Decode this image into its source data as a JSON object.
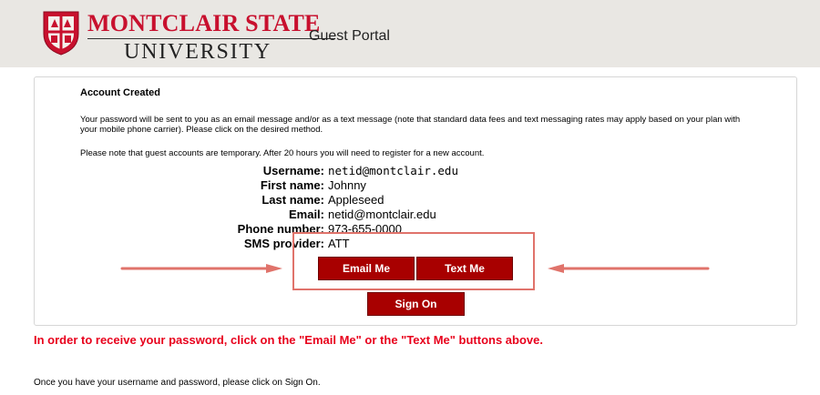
{
  "header": {
    "logo_top": "MONTCLAIR STATE",
    "logo_bottom": "UNIVERSITY",
    "portal_title": "Guest Portal",
    "brand_color": "#c8102e"
  },
  "card": {
    "title": "Account Created",
    "paragraph1": "Your password will be sent to you as an email message and/or as a text message (note that standard data fees and text messaging rates may apply based on your plan with your mobile phone carrier).  Please click on the desired method.",
    "paragraph2": "Please note that guest accounts are temporary. After 20 hours you will need to register for a new account.",
    "fields": [
      {
        "label": "Username:",
        "value": "netid@montclair.edu"
      },
      {
        "label": "First name:",
        "value": "Johnny"
      },
      {
        "label": "Last name:",
        "value": "Appleseed"
      },
      {
        "label": "Email:",
        "value": "netid@montclair.edu"
      },
      {
        "label": "Phone number:",
        "value": "973-655-0000"
      },
      {
        "label": "SMS provider:",
        "value": "ATT"
      }
    ],
    "buttons": {
      "email_me": "Email Me",
      "text_me": "Text Me",
      "sign_on": "Sign On"
    },
    "button_color": "#a80000",
    "highlight_color": "#e0736b"
  },
  "warning": "In order to receive your password, click on the \"Email Me\" or the \"Text Me\" buttons above.",
  "footer": "Once you have your username and password, please click on Sign On.",
  "icons": {
    "crest": "university-crest-icon",
    "arrows": "arrow-right-icon, arrow-left-icon"
  }
}
